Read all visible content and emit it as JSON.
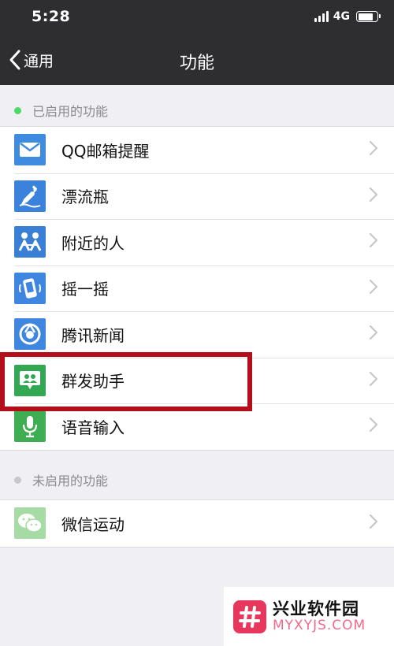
{
  "status": {
    "time": "5:28",
    "network": "4G",
    "battery_level": 0.8
  },
  "nav": {
    "back_label": "通用",
    "title": "功能"
  },
  "enabled": {
    "header": "已启用的功能",
    "dot_color": "#4cd964",
    "items": [
      {
        "label": "QQ邮箱提醒",
        "icon": "mail-icon",
        "color": "#3f8bdf"
      },
      {
        "label": "漂流瓶",
        "icon": "bottle-icon",
        "color": "#3a82db"
      },
      {
        "label": "附近的人",
        "icon": "people-nearby-icon",
        "color": "#3a7fd6"
      },
      {
        "label": "摇一摇",
        "icon": "shake-phone-icon",
        "color": "#3f86e0"
      },
      {
        "label": "腾讯新闻",
        "icon": "news-icon",
        "color": "#3f86e0"
      },
      {
        "label": "群发助手",
        "icon": "group-message-icon",
        "color": "#33a852"
      },
      {
        "label": "语音输入",
        "icon": "microphone-icon",
        "color": "#3fae53"
      }
    ]
  },
  "disabled": {
    "header": "未启用的功能",
    "dot_color": "#c7c7cc",
    "items": [
      {
        "label": "微信运动",
        "icon": "wechat-sport-icon",
        "color": "#a6dba6"
      }
    ]
  },
  "watermark": {
    "name": "兴业软件园",
    "url": "MYXYJS.COM",
    "accent": "#e8375c"
  },
  "colors": {
    "navbar": "#2e2e31",
    "highlight": "#b30e1a"
  }
}
